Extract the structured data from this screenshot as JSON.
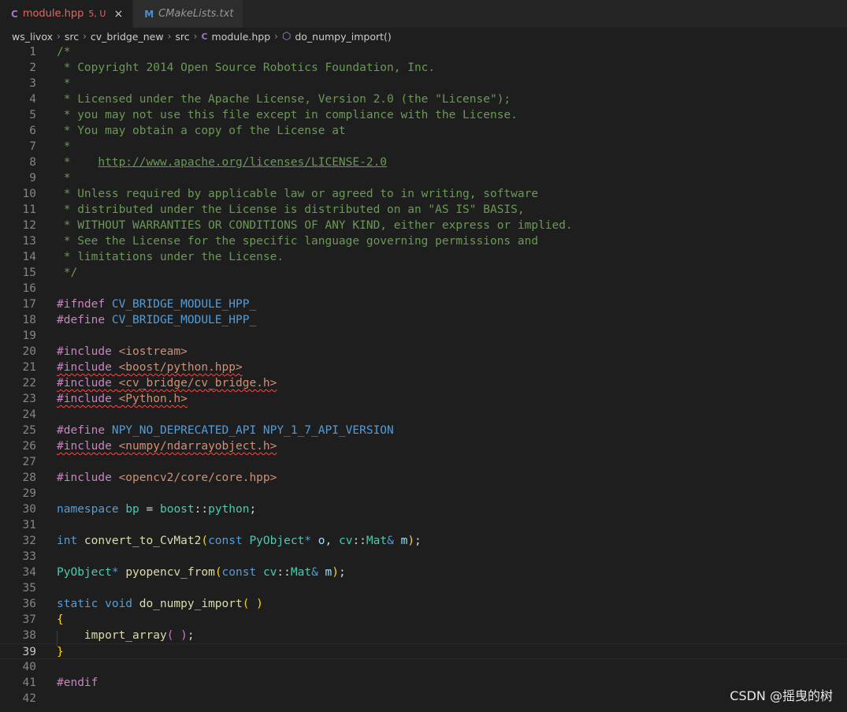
{
  "tabs": [
    {
      "icon": "C",
      "label": "module.hpp",
      "badge": "5, U",
      "close": "×",
      "active": true
    },
    {
      "icon": "M",
      "label": "CMakeLists.txt",
      "active": false
    }
  ],
  "breadcrumb": [
    "ws_livox",
    "src",
    "cv_bridge_new",
    "src",
    "module.hpp",
    "do_numpy_import()"
  ],
  "breadcrumb_sep": "›",
  "current_line": 39,
  "lines": [
    [
      [
        "com",
        "/*"
      ]
    ],
    [
      [
        "com",
        " * Copyright 2014 Open Source Robotics Foundation, Inc."
      ]
    ],
    [
      [
        "com",
        " *"
      ]
    ],
    [
      [
        "com",
        " * Licensed under the Apache License, Version 2.0 (the \"License\");"
      ]
    ],
    [
      [
        "com",
        " * you may not use this file except in compliance with the License."
      ]
    ],
    [
      [
        "com",
        " * You may obtain a copy of the License at"
      ]
    ],
    [
      [
        "com",
        " *"
      ]
    ],
    [
      [
        "com",
        " *    "
      ],
      [
        "link",
        "http://www.apache.org/licenses/LICENSE-2.0"
      ]
    ],
    [
      [
        "com",
        " *"
      ]
    ],
    [
      [
        "com",
        " * Unless required by applicable law or agreed to in writing, software"
      ]
    ],
    [
      [
        "com",
        " * distributed under the License is distributed on an \"AS IS\" BASIS,"
      ]
    ],
    [
      [
        "com",
        " * WITHOUT WARRANTIES OR CONDITIONS OF ANY KIND, either express or implied."
      ]
    ],
    [
      [
        "com",
        " * See the License for the specific language governing permissions and"
      ]
    ],
    [
      [
        "com",
        " * limitations under the License."
      ]
    ],
    [
      [
        "com",
        " */"
      ]
    ],
    [],
    [
      [
        "pp",
        "#ifndef "
      ],
      [
        "macro",
        "CV_BRIDGE_MODULE_HPP_"
      ]
    ],
    [
      [
        "pp",
        "#define "
      ],
      [
        "macro",
        "CV_BRIDGE_MODULE_HPP_"
      ]
    ],
    [],
    [
      [
        "pp",
        "#include "
      ],
      [
        "str",
        "<iostream>"
      ]
    ],
    [
      [
        "pp-sq",
        "#include "
      ],
      [
        "str-sq",
        "<boost/python.hpp>"
      ]
    ],
    [
      [
        "pp-sq",
        "#include "
      ],
      [
        "str-sq",
        "<cv_bridge/cv_bridge.h>"
      ]
    ],
    [
      [
        "pp-sq",
        "#include "
      ],
      [
        "str-sq",
        "<Python.h>"
      ]
    ],
    [],
    [
      [
        "pp",
        "#define "
      ],
      [
        "macro",
        "NPY_NO_DEPRECATED_API NPY_1_7_API_VERSION"
      ]
    ],
    [
      [
        "pp-sq",
        "#include "
      ],
      [
        "str-sq",
        "<numpy/ndarrayobject.h>"
      ]
    ],
    [],
    [
      [
        "pp",
        "#include "
      ],
      [
        "str",
        "<opencv2/core/core.hpp>"
      ]
    ],
    [],
    [
      [
        "kw",
        "namespace "
      ],
      [
        "ns",
        "bp"
      ],
      [
        "op",
        " = "
      ],
      [
        "ns",
        "boost"
      ],
      [
        "op",
        "::"
      ],
      [
        "ns",
        "python"
      ],
      [
        "op",
        ";"
      ]
    ],
    [],
    [
      [
        "kw",
        "int "
      ],
      [
        "fn",
        "convert_to_CvMat2"
      ],
      [
        "p1",
        "("
      ],
      [
        "kw",
        "const "
      ],
      [
        "type",
        "PyObject"
      ],
      [
        "kw",
        "* "
      ],
      [
        "var",
        "o"
      ],
      [
        "op",
        ", "
      ],
      [
        "ns",
        "cv"
      ],
      [
        "op",
        "::"
      ],
      [
        "type",
        "Mat"
      ],
      [
        "kw",
        "& "
      ],
      [
        "var",
        "m"
      ],
      [
        "p1",
        ")"
      ],
      [
        "op",
        ";"
      ]
    ],
    [],
    [
      [
        "type",
        "PyObject"
      ],
      [
        "kw",
        "* "
      ],
      [
        "fn",
        "pyopencv_from"
      ],
      [
        "p1",
        "("
      ],
      [
        "kw",
        "const "
      ],
      [
        "ns",
        "cv"
      ],
      [
        "op",
        "::"
      ],
      [
        "type",
        "Mat"
      ],
      [
        "kw",
        "& "
      ],
      [
        "var",
        "m"
      ],
      [
        "p1",
        ")"
      ],
      [
        "op",
        ";"
      ]
    ],
    [],
    [
      [
        "kw",
        "static "
      ],
      [
        "kw",
        "void "
      ],
      [
        "fn",
        "do_numpy_import"
      ],
      [
        "p1",
        "( )"
      ]
    ],
    [
      [
        "p1",
        "{"
      ]
    ],
    [
      [
        "op",
        "    "
      ],
      [
        "fn",
        "import_array"
      ],
      [
        "p2",
        "( )"
      ],
      [
        "op",
        ";"
      ]
    ],
    [
      [
        "p1",
        "}"
      ]
    ],
    [],
    [
      [
        "pp",
        "#endif"
      ]
    ],
    []
  ],
  "watermark": "CSDN @摇曳的树"
}
